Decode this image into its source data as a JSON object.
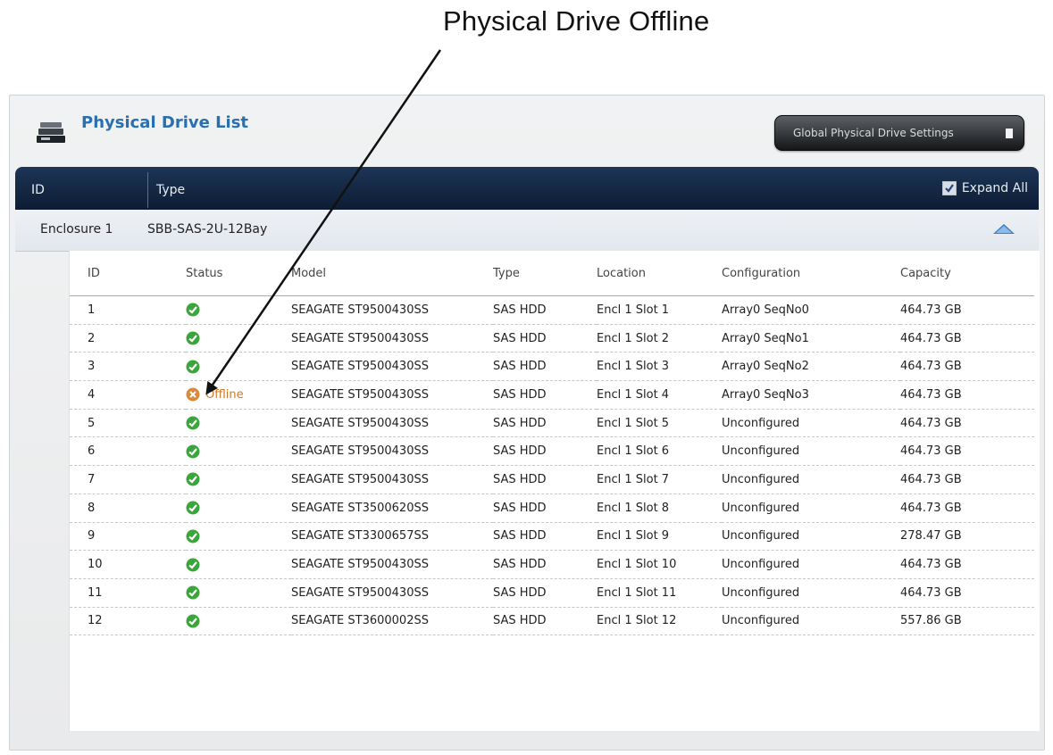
{
  "callout": {
    "text": "Physical Drive Offline"
  },
  "panel": {
    "title": "Physical Drive List",
    "global_settings_label": "Global Physical Drive Settings"
  },
  "header": {
    "id_label": "ID",
    "type_label": "Type",
    "expand_all_label": "Expand All",
    "expand_all_checked": true
  },
  "enclosure": {
    "id": "Enclosure 1",
    "type": "SBB-SAS-2U-12Bay"
  },
  "table": {
    "columns": [
      "ID",
      "Status",
      "Model",
      "Type",
      "Location",
      "Configuration",
      "Capacity"
    ],
    "rows": [
      {
        "id": "1",
        "status": "ok",
        "status_text": "",
        "model": "SEAGATE ST9500430SS",
        "type": "SAS HDD",
        "location": "Encl 1 Slot 1",
        "configuration": "Array0 SeqNo0",
        "capacity": "464.73 GB"
      },
      {
        "id": "2",
        "status": "ok",
        "status_text": "",
        "model": "SEAGATE ST9500430SS",
        "type": "SAS HDD",
        "location": "Encl 1 Slot 2",
        "configuration": "Array0 SeqNo1",
        "capacity": "464.73 GB"
      },
      {
        "id": "3",
        "status": "ok",
        "status_text": "",
        "model": "SEAGATE ST9500430SS",
        "type": "SAS HDD",
        "location": "Encl 1 Slot 3",
        "configuration": "Array0 SeqNo2",
        "capacity": "464.73 GB"
      },
      {
        "id": "4",
        "status": "offline",
        "status_text": "Offline",
        "model": "SEAGATE ST9500430SS",
        "type": "SAS HDD",
        "location": "Encl 1 Slot 4",
        "configuration": "Array0 SeqNo3",
        "capacity": "464.73 GB"
      },
      {
        "id": "5",
        "status": "ok",
        "status_text": "",
        "model": "SEAGATE ST9500430SS",
        "type": "SAS HDD",
        "location": "Encl 1 Slot 5",
        "configuration": "Unconfigured",
        "capacity": "464.73 GB"
      },
      {
        "id": "6",
        "status": "ok",
        "status_text": "",
        "model": "SEAGATE ST9500430SS",
        "type": "SAS HDD",
        "location": "Encl 1 Slot 6",
        "configuration": "Unconfigured",
        "capacity": "464.73 GB"
      },
      {
        "id": "7",
        "status": "ok",
        "status_text": "",
        "model": "SEAGATE ST9500430SS",
        "type": "SAS HDD",
        "location": "Encl 1 Slot 7",
        "configuration": "Unconfigured",
        "capacity": "464.73 GB"
      },
      {
        "id": "8",
        "status": "ok",
        "status_text": "",
        "model": "SEAGATE ST3500620SS",
        "type": "SAS HDD",
        "location": "Encl 1 Slot 8",
        "configuration": "Unconfigured",
        "capacity": "464.73 GB"
      },
      {
        "id": "9",
        "status": "ok",
        "status_text": "",
        "model": "SEAGATE ST3300657SS",
        "type": "SAS HDD",
        "location": "Encl 1 Slot 9",
        "configuration": "Unconfigured",
        "capacity": "278.47 GB"
      },
      {
        "id": "10",
        "status": "ok",
        "status_text": "",
        "model": "SEAGATE ST9500430SS",
        "type": "SAS HDD",
        "location": "Encl 1 Slot 10",
        "configuration": "Unconfigured",
        "capacity": "464.73 GB"
      },
      {
        "id": "11",
        "status": "ok",
        "status_text": "",
        "model": "SEAGATE ST9500430SS",
        "type": "SAS HDD",
        "location": "Encl 1 Slot 11",
        "configuration": "Unconfigured",
        "capacity": "464.73 GB"
      },
      {
        "id": "12",
        "status": "ok",
        "status_text": "",
        "model": "SEAGATE ST3600002SS",
        "type": "SAS HDD",
        "location": "Encl 1 Slot 12",
        "configuration": "Unconfigured",
        "capacity": "557.86 GB"
      }
    ]
  },
  "colors": {
    "ok": "#3aa53a",
    "offline": "#d98b3a",
    "header_bg": "#13243f",
    "title": "#2a6fb0"
  },
  "icons": {
    "ok": "check-circle-icon",
    "offline": "x-circle-icon",
    "panel": "drive-stack-icon",
    "collapse": "chevron-up-icon"
  }
}
